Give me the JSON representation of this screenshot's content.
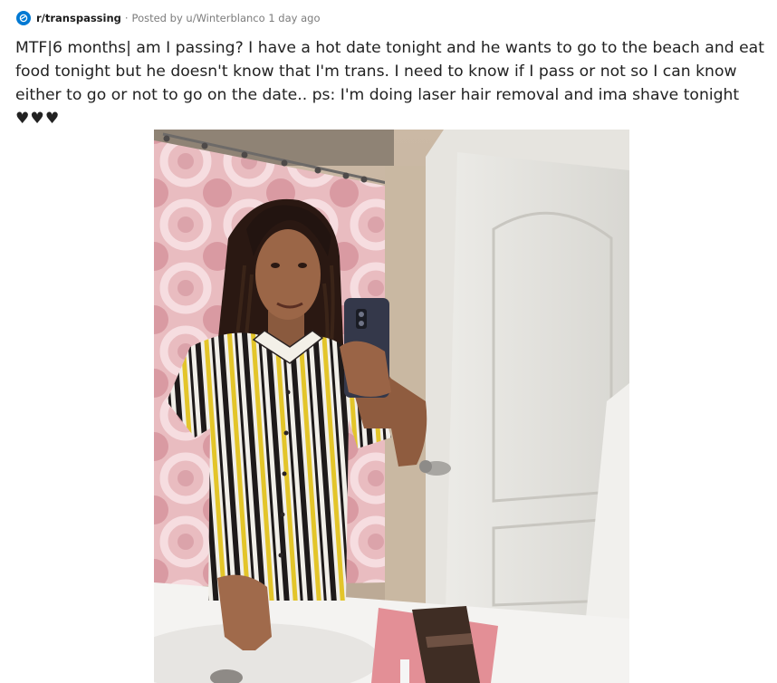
{
  "post": {
    "subreddit": "r/transpassing",
    "separator": "·",
    "posted_by": "Posted by u/Winterblanco 1 day ago",
    "title": "MTF|6 months| am I passing? I have a hot date tonight and he wants to go to the beach and eat food tonight but he doesn't know that I'm trans. I need to know if I pass or not so I can know either to go or not to go on the date.. ps: I'm doing laser hair removal and ima shave tonight ",
    "title_hearts": "♥♥♥"
  },
  "colors": {
    "subreddit_icon": "#0079d3",
    "meta_text": "#7c7c7c",
    "title_text": "#222222"
  },
  "icons": {
    "subreddit_icon": "community-icon"
  }
}
